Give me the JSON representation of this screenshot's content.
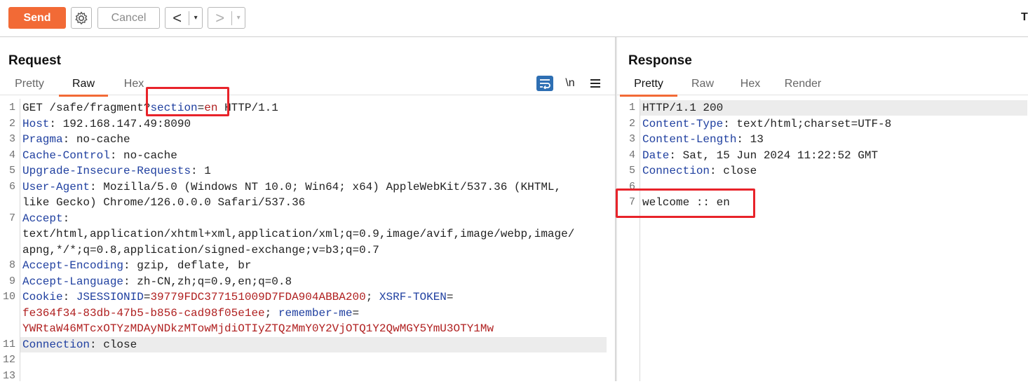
{
  "toolbar": {
    "send_label": "Send",
    "settings_icon": "gear-icon",
    "cancel_label": "Cancel",
    "back_arrow": "<",
    "forward_arrow": ">",
    "dropdown_arrow": "▾",
    "truncated_char": "T"
  },
  "request": {
    "title": "Request",
    "tabs": [
      "Pretty",
      "Raw",
      "Hex"
    ],
    "active_tab": "Raw",
    "icons": [
      "wrap-lines-icon",
      "newline-icon",
      "menu-icon"
    ],
    "newline_label": "\\n",
    "lines": [
      {
        "n": "1",
        "segments": [
          {
            "t": "GET /safe/fragment",
            "c": "v"
          },
          {
            "t": "?",
            "c": "v"
          },
          {
            "t": "section",
            "c": "k"
          },
          {
            "t": "=",
            "c": "v"
          },
          {
            "t": "en",
            "c": "cv"
          },
          {
            "t": " HTTP/1.1",
            "c": "v"
          }
        ]
      },
      {
        "n": "2",
        "segments": [
          {
            "t": "Host",
            "c": "k"
          },
          {
            "t": ": 192.168.147.49:8090",
            "c": "v"
          }
        ]
      },
      {
        "n": "3",
        "segments": [
          {
            "t": "Pragma",
            "c": "k"
          },
          {
            "t": ": no-cache",
            "c": "v"
          }
        ]
      },
      {
        "n": "4",
        "segments": [
          {
            "t": "Cache-Control",
            "c": "k"
          },
          {
            "t": ": no-cache",
            "c": "v"
          }
        ]
      },
      {
        "n": "5",
        "segments": [
          {
            "t": "Upgrade-Insecure-Requests",
            "c": "k"
          },
          {
            "t": ": 1",
            "c": "v"
          }
        ]
      },
      {
        "n": "6",
        "segments": [
          {
            "t": "User-Agent",
            "c": "k"
          },
          {
            "t": ": Mozilla/5.0 (Windows NT 10.0; Win64; x64) AppleWebKit/537.36 (KHTML,",
            "c": "v"
          }
        ]
      },
      {
        "n": "",
        "segments": [
          {
            "t": "like Gecko) Chrome/126.0.0.0 Safari/537.36",
            "c": "v"
          }
        ]
      },
      {
        "n": "7",
        "segments": [
          {
            "t": "Accept",
            "c": "k"
          },
          {
            "t": ":",
            "c": "v"
          }
        ]
      },
      {
        "n": "",
        "segments": [
          {
            "t": "text/html,application/xhtml+xml,application/xml;q=0.9,image/avif,image/webp,image/",
            "c": "v"
          }
        ]
      },
      {
        "n": "",
        "segments": [
          {
            "t": "apng,*/*;q=0.8,application/signed-exchange;v=b3;q=0.7",
            "c": "v"
          }
        ]
      },
      {
        "n": "8",
        "segments": [
          {
            "t": "Accept-Encoding",
            "c": "k"
          },
          {
            "t": ": gzip, deflate, br",
            "c": "v"
          }
        ]
      },
      {
        "n": "9",
        "segments": [
          {
            "t": "Accept-Language",
            "c": "k"
          },
          {
            "t": ": zh-CN,zh;q=0.9,en;q=0.8",
            "c": "v"
          }
        ]
      },
      {
        "n": "10",
        "segments": [
          {
            "t": "Cookie",
            "c": "k"
          },
          {
            "t": ": ",
            "c": "v"
          },
          {
            "t": "JSESSIONID",
            "c": "ck"
          },
          {
            "t": "=",
            "c": "v"
          },
          {
            "t": "39779FDC377151009D7FDA904ABBA200",
            "c": "cv"
          },
          {
            "t": "; ",
            "c": "v"
          },
          {
            "t": "XSRF-TOKEN",
            "c": "ck"
          },
          {
            "t": "=",
            "c": "v"
          }
        ]
      },
      {
        "n": "",
        "segments": [
          {
            "t": "fe364f34-83db-47b5-b856-cad98f05e1ee",
            "c": "cv"
          },
          {
            "t": "; ",
            "c": "v"
          },
          {
            "t": "remember-me",
            "c": "ck"
          },
          {
            "t": "=",
            "c": "v"
          }
        ]
      },
      {
        "n": "",
        "segments": [
          {
            "t": "YWRtaW46MTcxOTYzMDAyNDkzMTowMjdiOTIyZTQzMmY0Y2VjOTQ1Y2QwMGY5YmU3OTY1Mw",
            "c": "cv"
          }
        ]
      },
      {
        "n": "11",
        "segments": [
          {
            "t": "Connection",
            "c": "k"
          },
          {
            "t": ": close",
            "c": "v"
          }
        ]
      },
      {
        "n": "12",
        "segments": []
      },
      {
        "n": "13",
        "segments": []
      }
    ]
  },
  "response": {
    "title": "Response",
    "tabs": [
      "Pretty",
      "Raw",
      "Hex",
      "Render"
    ],
    "active_tab": "Pretty",
    "lines": [
      {
        "n": "1",
        "segments": [
          {
            "t": "HTTP/1.1 200",
            "c": "v"
          }
        ]
      },
      {
        "n": "2",
        "segments": [
          {
            "t": "Content-Type",
            "c": "k"
          },
          {
            "t": ": text/html;charset=UTF-8",
            "c": "v"
          }
        ]
      },
      {
        "n": "3",
        "segments": [
          {
            "t": "Content-Length",
            "c": "k"
          },
          {
            "t": ": 13",
            "c": "v"
          }
        ]
      },
      {
        "n": "4",
        "segments": [
          {
            "t": "Date",
            "c": "k"
          },
          {
            "t": ": Sat, 15 Jun 2024 11:22:52 GMT",
            "c": "v"
          }
        ]
      },
      {
        "n": "5",
        "segments": [
          {
            "t": "Connection",
            "c": "k"
          },
          {
            "t": ": close",
            "c": "v"
          }
        ]
      },
      {
        "n": "6",
        "segments": []
      },
      {
        "n": "7",
        "segments": [
          {
            "t": "welcome :: en",
            "c": "v"
          }
        ]
      }
    ]
  },
  "colors": {
    "accent": "#f26a36",
    "highlight_box": "#e8232a",
    "header_key": "#2040a0",
    "cookie_value": "#b02020"
  }
}
